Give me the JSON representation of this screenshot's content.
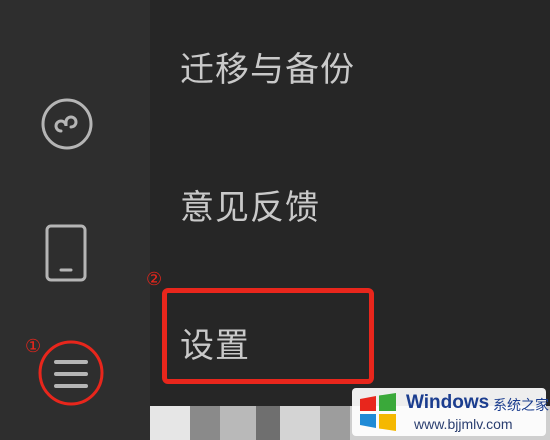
{
  "menu": {
    "items": [
      {
        "label": "迁移与备份"
      },
      {
        "label": "意见反馈"
      },
      {
        "label": "设置"
      }
    ]
  },
  "sidebar": {
    "icons": [
      "miniprogram-icon",
      "phone-icon",
      "menu-icon"
    ]
  },
  "annotations": {
    "steps": [
      "①",
      "②"
    ],
    "highlight_color": "#e8261c"
  },
  "watermark": {
    "brand": "Windows",
    "brand_cn": "系统之家",
    "url": "www.bjjmlv.com"
  },
  "colors": {
    "sidebar_bg": "#2e2e2e",
    "menu_bg": "#262626",
    "menu_text": "#c9c9c9",
    "icon": "#b5b5b5"
  }
}
